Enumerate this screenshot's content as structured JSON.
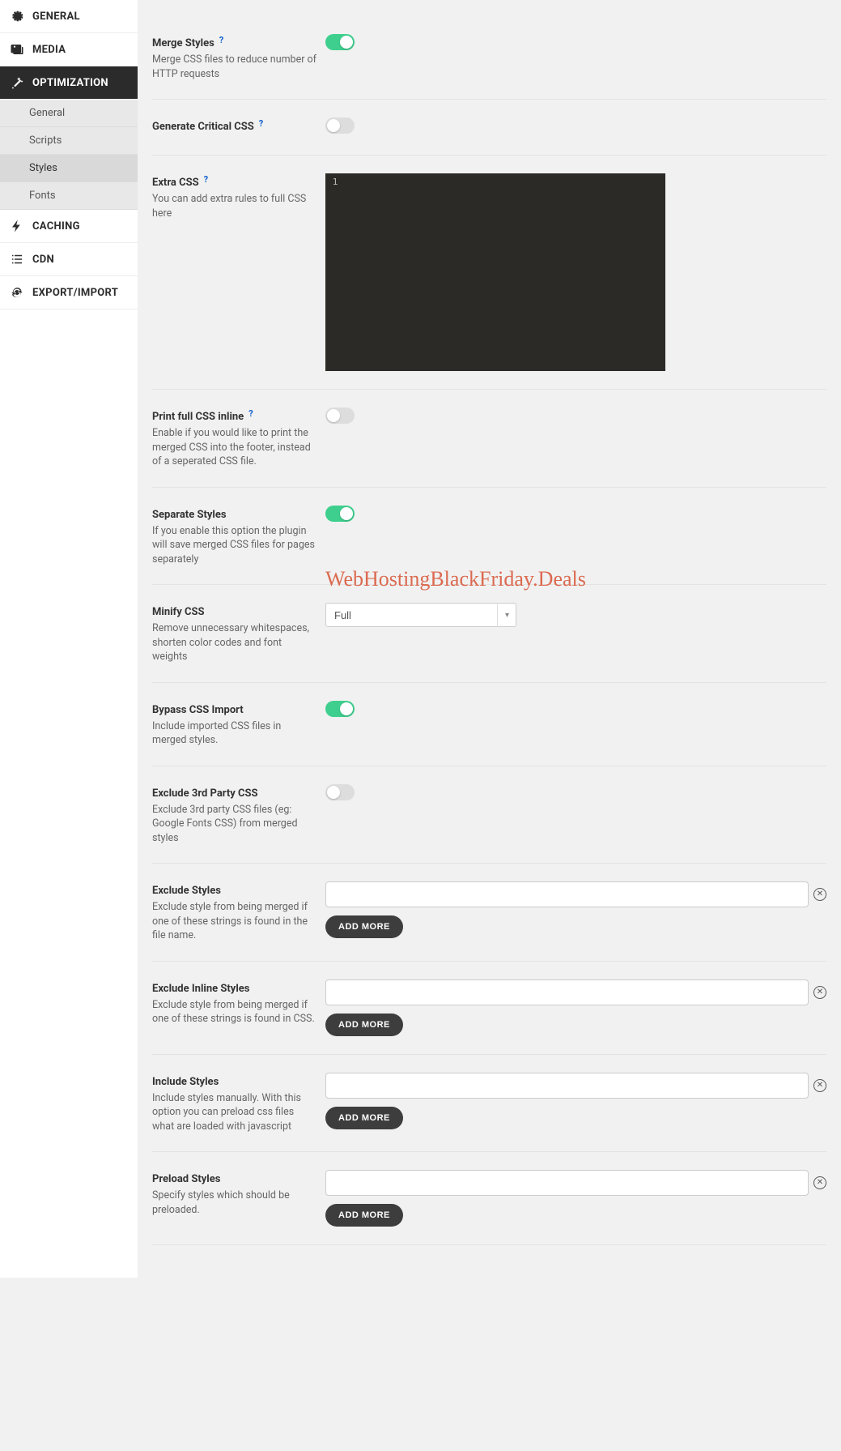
{
  "sidebar": {
    "items": [
      {
        "label": "GENERAL",
        "icon": "gear"
      },
      {
        "label": "MEDIA",
        "icon": "media"
      },
      {
        "label": "OPTIMIZATION",
        "icon": "wand",
        "active": true
      },
      {
        "label": "CACHING",
        "icon": "bolt"
      },
      {
        "label": "CDN",
        "icon": "list"
      },
      {
        "label": "EXPORT/IMPORT",
        "icon": "refresh"
      }
    ],
    "sub_items": [
      {
        "label": "General"
      },
      {
        "label": "Scripts"
      },
      {
        "label": "Styles",
        "active": true
      },
      {
        "label": "Fonts"
      }
    ]
  },
  "settings": {
    "merge_styles": {
      "title": "Merge Styles",
      "help": true,
      "desc": "Merge CSS files to reduce number of HTTP requests",
      "toggle": true
    },
    "generate_critical": {
      "title": "Generate Critical CSS",
      "help": true,
      "desc": "",
      "toggle": false
    },
    "extra_css": {
      "title": "Extra CSS",
      "help": true,
      "desc": "You can add extra rules to full CSS here",
      "editor_line": "1"
    },
    "print_inline": {
      "title": "Print full CSS inline",
      "help": true,
      "desc": "Enable if you would like to print the merged CSS into the footer, instead of a seperated CSS file.",
      "toggle": false
    },
    "separate_styles": {
      "title": "Separate Styles",
      "help": false,
      "desc": "If you enable this option the plugin will save merged CSS files for pages separately",
      "toggle": true
    },
    "minify_css": {
      "title": "Minify CSS",
      "help": false,
      "desc": "Remove unnecessary whitespaces, shorten color codes and font weights",
      "select_value": "Full",
      "options": [
        "Full"
      ]
    },
    "bypass_import": {
      "title": "Bypass CSS Import",
      "help": false,
      "desc": "Include imported CSS files in merged styles.",
      "toggle": true
    },
    "exclude_3rd": {
      "title": "Exclude 3rd Party CSS",
      "help": false,
      "desc": "Exclude 3rd party CSS files (eg: Google Fonts CSS) from merged styles",
      "toggle": false
    },
    "exclude_styles": {
      "title": "Exclude Styles",
      "help": false,
      "desc": "Exclude style from being merged if one of these strings is found in the file name.",
      "button": "ADD MORE"
    },
    "exclude_inline": {
      "title": "Exclude Inline Styles",
      "help": false,
      "desc": "Exclude style from being merged if one of these strings is found in CSS.",
      "button": "ADD MORE"
    },
    "include_styles": {
      "title": "Include Styles",
      "help": false,
      "desc": "Include styles manually. With this option you can preload css files what are loaded with javascript",
      "button": "ADD MORE"
    },
    "preload_styles": {
      "title": "Preload Styles",
      "help": false,
      "desc": "Specify styles which should be preloaded.",
      "button": "ADD MORE"
    }
  },
  "watermark": "WebHostingBlackFriday.Deals"
}
